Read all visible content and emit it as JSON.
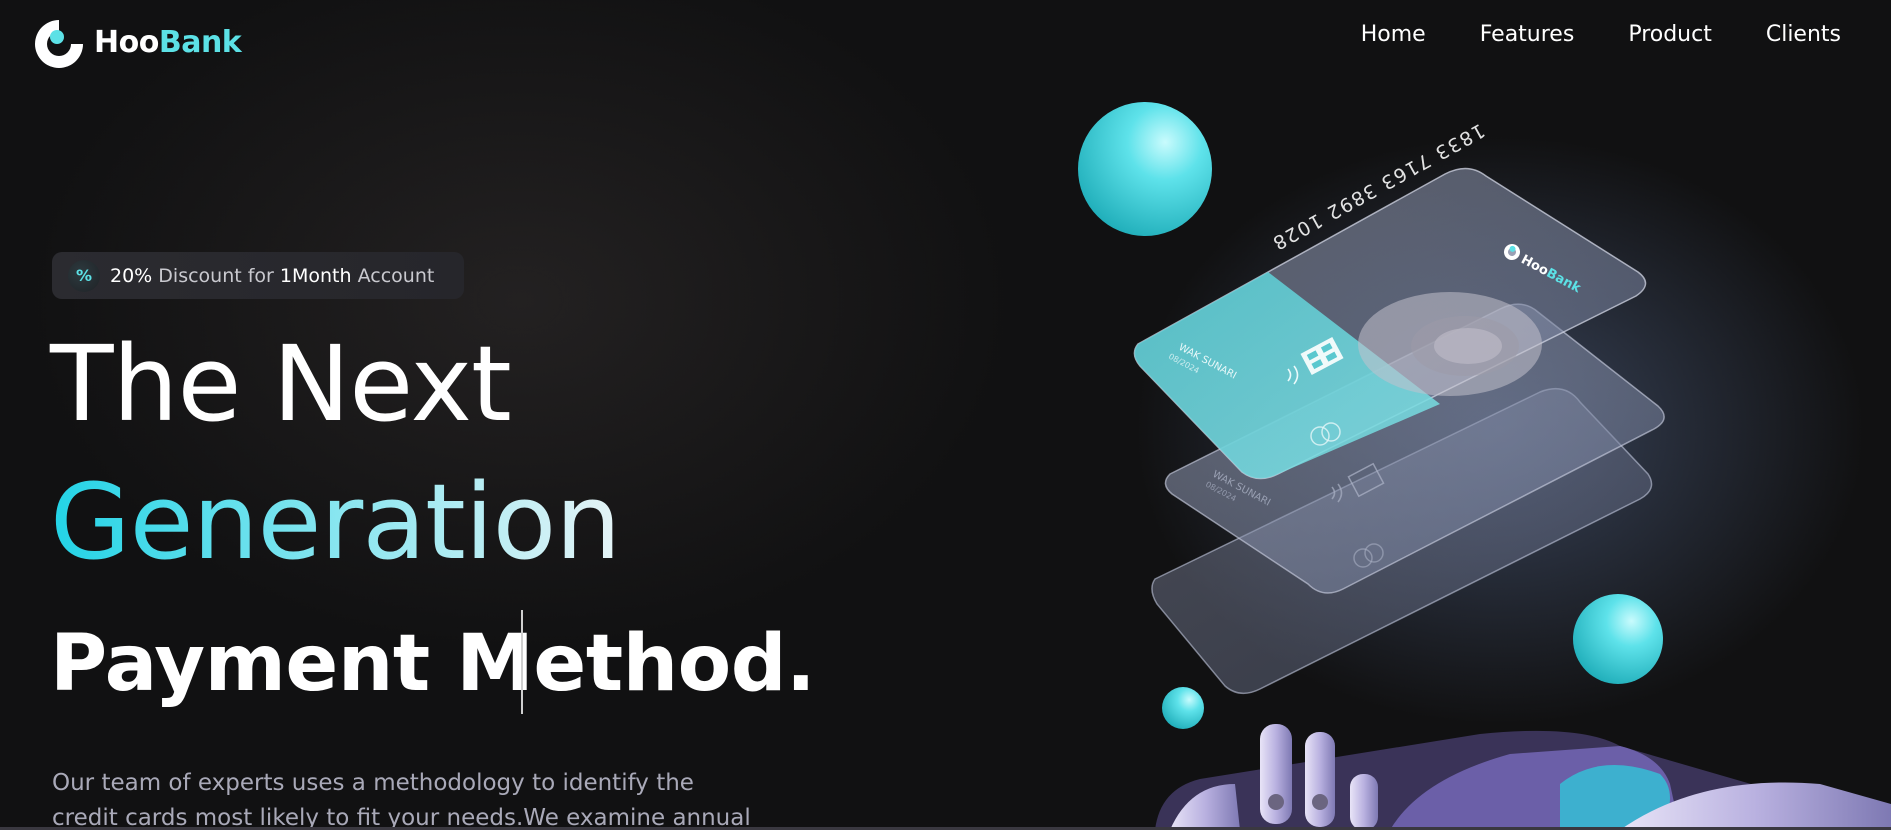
{
  "brand": {
    "name_part1": "Hoo",
    "name_part2": "Bank",
    "accent_color": "#5ce1e6"
  },
  "nav": {
    "items": [
      "Home",
      "Features",
      "Product",
      "Clients"
    ]
  },
  "promo": {
    "icon": "percent-icon",
    "discount": "20%",
    "text1": "Discount for",
    "duration": "1Month",
    "text2": "Account"
  },
  "hero": {
    "line1": "The Next",
    "line2": "Generation",
    "line3": "Payment Method.",
    "paragraph": "Our team of experts uses a methodology to identify the credit cards most likely to fit your needs.We examine annual percentage"
  },
  "card": {
    "number": "1833 7163 3892 1028",
    "holder": "WAK SUNARI",
    "expiry": "08/2024",
    "brand_part1": "Hoo",
    "brand_part2": "Bank"
  }
}
